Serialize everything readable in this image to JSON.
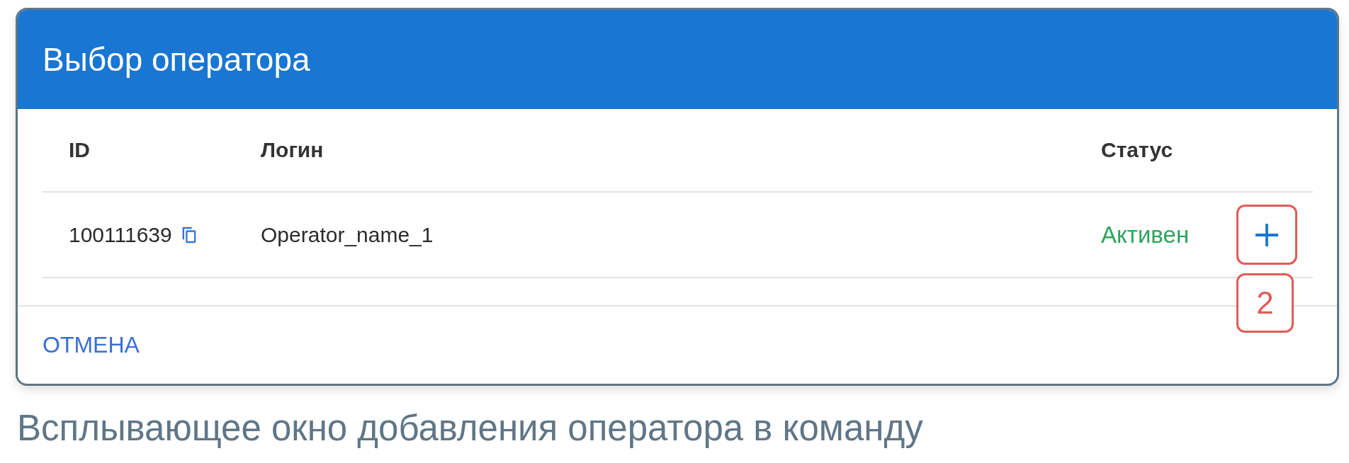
{
  "dialog": {
    "title": "Выбор оператора",
    "table": {
      "columns": [
        "ID",
        "Логин",
        "Статус"
      ],
      "rows": [
        {
          "id": "100111639",
          "login": "Operator_name_1",
          "status": {
            "text": "Активен",
            "color": "#2fa45c"
          },
          "highlighted": true,
          "callout": "2"
        }
      ]
    },
    "cancel_button": "ОТМЕНА"
  },
  "caption": "Всплывающее окно добавления оператора в команду"
}
